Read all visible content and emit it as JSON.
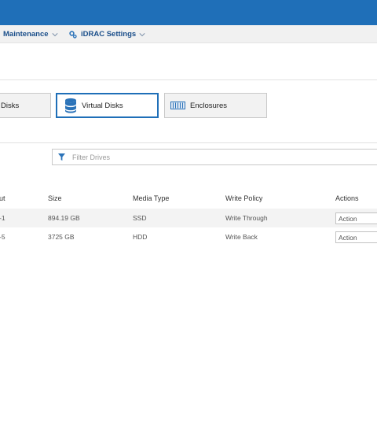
{
  "menubar": {
    "maintenance_label": "Maintenance",
    "idrac_settings_label": "iDRAC Settings"
  },
  "tiles": {
    "physical_disks_label": "Disks",
    "virtual_disks_label": "Virtual Disks",
    "enclosures_label": "Enclosures"
  },
  "filter": {
    "placeholder": "Filter Drives"
  },
  "table": {
    "headers": {
      "layout": "ut",
      "size": "Size",
      "media_type": "Media Type",
      "write_policy": "Write Policy",
      "actions": "Actions"
    },
    "rows": [
      {
        "layout": "-1",
        "size": "894.19 GB",
        "media_type": "SSD",
        "write_policy": "Write Through",
        "action": "Action"
      },
      {
        "layout": "-5",
        "size": "3725 GB",
        "media_type": "HDD",
        "write_policy": "Write Back",
        "action": "Action"
      }
    ]
  },
  "colors": {
    "brand_blue": "#1f6fb8",
    "link_blue": "#1a4e8a",
    "icon_blue": "#2b73b9"
  }
}
